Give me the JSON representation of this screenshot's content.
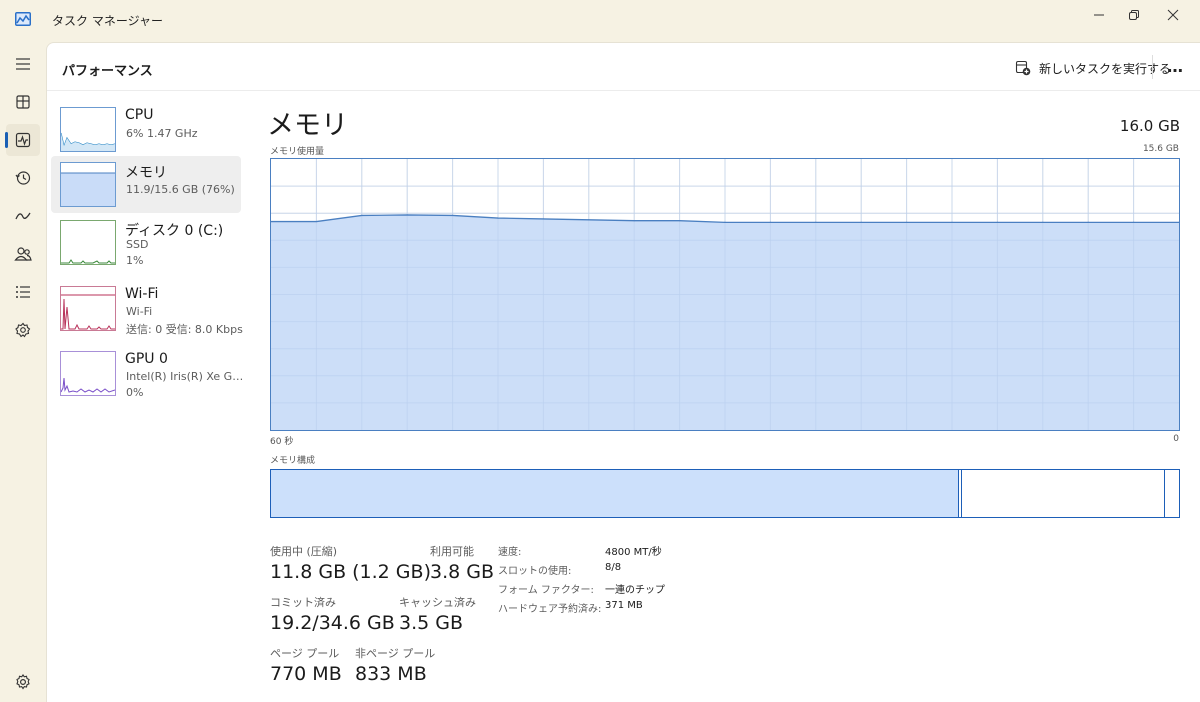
{
  "window": {
    "title": "タスク マネージャー"
  },
  "rail": {
    "items": [
      {
        "icon": "hamburger-menu-icon"
      },
      {
        "icon": "processes-icon"
      },
      {
        "icon": "performance-icon",
        "active": true
      },
      {
        "icon": "app-history-icon"
      },
      {
        "icon": "startup-apps-icon"
      },
      {
        "icon": "users-icon"
      },
      {
        "icon": "details-icon"
      },
      {
        "icon": "services-icon"
      }
    ],
    "settings_icon": "settings-icon"
  },
  "header": {
    "title": "パフォーマンス",
    "run_task_label": "新しいタスクを実行する",
    "more_label": "…"
  },
  "devices": [
    {
      "name": "CPU",
      "sub1": "6%  1.47 GHz",
      "sub2": "",
      "sub3": "",
      "color": "#1a7fc1"
    },
    {
      "name": "メモリ",
      "sub1": "11.9/15.6 GB (76%)",
      "sub2": "",
      "sub3": "",
      "color": "#1d5fb8",
      "active": true
    },
    {
      "name": "ディスク 0 (C:)",
      "sub1": "SSD",
      "sub2": "1%",
      "sub3": "",
      "color": "#3c8a3c"
    },
    {
      "name": "Wi-Fi",
      "sub1": "Wi-Fi",
      "sub2": "送信: 0  受信: 8.0 Kbps",
      "sub3": "",
      "color": "#b8325a"
    },
    {
      "name": "GPU 0",
      "sub1": "Intel(R) Iris(R) Xe Grap...",
      "sub2": "0%",
      "sub3": "",
      "color": "#7a4fc9"
    }
  ],
  "detail": {
    "title": "メモリ",
    "total": "16.0 GB",
    "usage_label": "メモリ使用量",
    "usage_max": "15.6 GB",
    "axis_left": "60 秒",
    "axis_right": "0",
    "composition_label": "メモリ構成"
  },
  "chart_data": {
    "type": "area",
    "title": "メモリ使用量",
    "x": [
      60,
      57,
      54,
      51,
      48,
      45,
      42,
      39,
      36,
      33,
      30,
      27,
      24,
      21,
      18,
      15,
      12,
      9,
      6,
      3,
      0
    ],
    "series": [
      {
        "values": [
          12.0,
          12.0,
          12.35,
          12.38,
          12.35,
          12.2,
          12.15,
          12.1,
          12.05,
          12.05,
          11.95,
          11.95,
          11.95,
          11.95,
          11.95,
          11.95,
          11.95,
          11.95,
          11.95,
          11.95,
          11.95
        ]
      }
    ],
    "xlim": [
      60,
      0
    ],
    "ylim": [
      0,
      15.6
    ],
    "grid": true,
    "color": "#4a7fc1",
    "fill": "#c9dcf8"
  },
  "stats": {
    "in_use_label": "使用中 (圧縮)",
    "in_use_value": "11.8 GB (1.2 GB)",
    "available_label": "利用可能",
    "available_value": "3.8 GB",
    "committed_label": "コミット済み",
    "committed_value": "19.2/34.6 GB",
    "cached_label": "キャッシュ済み",
    "cached_value": "3.5 GB",
    "paged_label": "ページ プール",
    "paged_value": "770 MB",
    "nonpaged_label": "非ページ プール",
    "nonpaged_value": "833 MB"
  },
  "specs": [
    {
      "key": "速度:",
      "value": "4800 MT/秒"
    },
    {
      "key": "スロットの使用:",
      "value": "8/8"
    },
    {
      "key": "フォーム ファクター:",
      "value": "一連のチップ"
    },
    {
      "key": "ハードウェア予約済み:",
      "value": "371 MB"
    }
  ]
}
